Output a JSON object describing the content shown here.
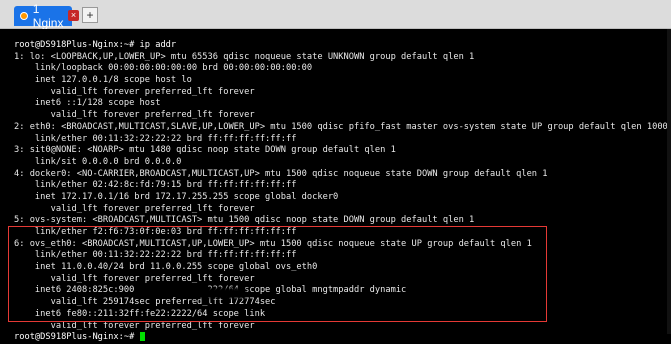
{
  "tab": {
    "label": "1 Nginx",
    "close_symbol": "×",
    "add_symbol": "+"
  },
  "colors": {
    "accent": "#1a73e8",
    "highlight": "#e53935",
    "cursor": "#00e000"
  },
  "terminal": {
    "lines": [
      "root@DS918Plus-Nginx:~# ip addr",
      "1: lo: <LOOPBACK,UP,LOWER_UP> mtu 65536 qdisc noqueue state UNKNOWN group default qlen 1",
      "    link/loopback 00:00:00:00:00:00 brd 00:00:00:00:00:00",
      "    inet 127.0.0.1/8 scope host lo",
      "       valid_lft forever preferred_lft forever",
      "    inet6 ::1/128 scope host",
      "       valid_lft forever preferred_lft forever",
      "2: eth0: <BROADCAST,MULTICAST,SLAVE,UP,LOWER_UP> mtu 1500 qdisc pfifo_fast master ovs-system state UP group default qlen 1000",
      "    link/ether 00:11:32:22:22:22 brd ff:ff:ff:ff:ff:ff",
      "3: sit0@NONE: <NOARP> mtu 1480 qdisc noop state DOWN group default qlen 1",
      "    link/sit 0.0.0.0 brd 0.0.0.0",
      "4: docker0: <NO-CARRIER,BROADCAST,MULTICAST,UP> mtu 1500 qdisc noqueue state DOWN group default qlen 1",
      "    link/ether 02:42:8c:fd:79:15 brd ff:ff:ff:ff:ff:ff",
      "    inet 172.17.0.1/16 brd 172.17.255.255 scope global docker0",
      "       valid_lft forever preferred_lft forever",
      "5: ovs-system: <BROADCAST,MULTICAST> mtu 1500 qdisc noop state DOWN group default qlen 1",
      "    link/ether f2:f6:73:0f:0e:03 brd ff:ff:ff:ff:ff:ff",
      "6: ovs_eth0: <BROADCAST,MULTICAST,UP,LOWER_UP> mtu 1500 qdisc noqueue state UP group default qlen 1",
      "    link/ether 00:11:32:22:22:22 brd ff:ff:ff:ff:ff:ff",
      "    inet 11.0.0.40/24 brd 11.0.0.255 scope global ovs_eth0",
      "       valid_lft forever preferred_lft forever",
      "    inet6 2408:825c:900              222/64 scope global mngtmpaddr dynamic",
      "       valid_lft 259174sec preferred_lft 172774sec",
      "    inet6 fe80::211:32ff:fe22:2222/64 scope link",
      "       valid_lft forever preferred_lft forever",
      "root@DS918Plus-Nginx:~# "
    ]
  }
}
